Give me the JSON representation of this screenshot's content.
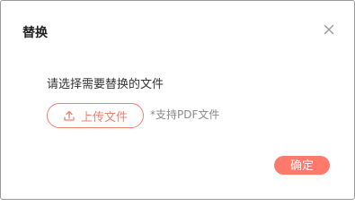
{
  "dialog": {
    "title": "替换",
    "close_icon": "close-icon",
    "prompt": "请选择需要替换的文件",
    "upload_button": {
      "icon": "upload-icon",
      "label": "上传文件"
    },
    "hint": "*支持PDF文件",
    "confirm_label": "确定"
  },
  "colors": {
    "accent": "#f08070",
    "confirm_bg": "#ff7a6a",
    "hint_text": "#8a8a8a"
  }
}
